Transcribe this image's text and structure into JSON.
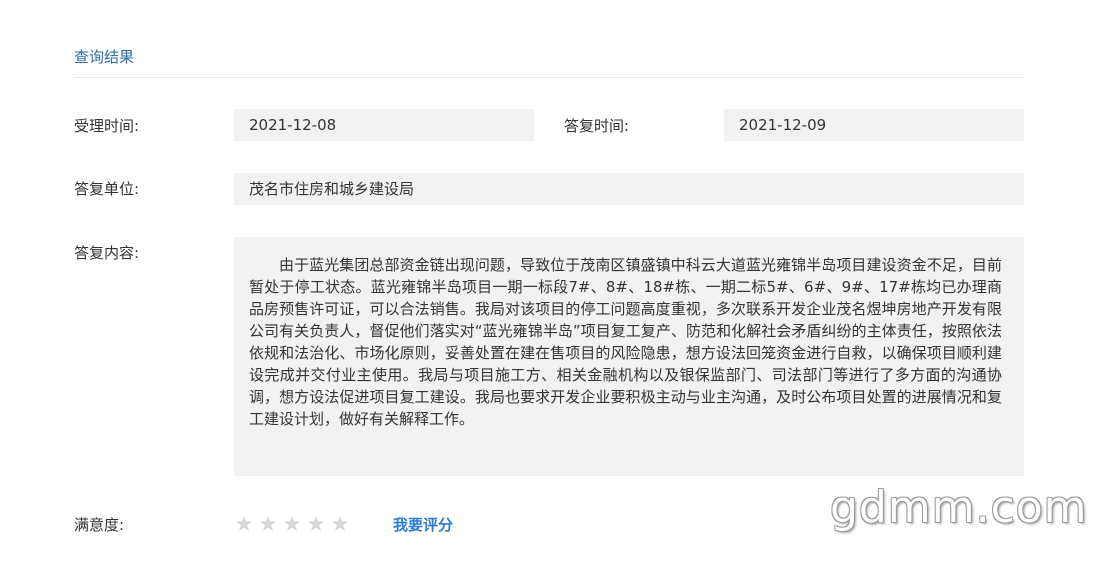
{
  "section_title": "查询结果",
  "accept_time": {
    "label": "受理时间:",
    "value": "2021-12-08"
  },
  "reply_time": {
    "label": "答复时间:",
    "value": "2021-12-09"
  },
  "reply_unit": {
    "label": "答复单位:",
    "value": "茂名市住房和城乡建设局"
  },
  "reply_content": {
    "label": "答复内容:",
    "text": "由于蓝光集团总部资金链出现问题，导致位于茂南区镇盛镇中科云大道蓝光雍锦半岛项目建设资金不足，目前暂处于停工状态。蓝光雍锦半岛项目一期一标段7#、8#、18#栋、一期二标5#、6#、9#、17#栋均已办理商品房预售许可证，可以合法销售。我局对该项目的停工问题高度重视，多次联系开发企业茂名煜坤房地产开发有限公司有关负责人，督促他们落实对“蓝光雍锦半岛”项目复工复产、防范和化解社会矛盾纠纷的主体责任，按照依法依规和法治化、市场化原则，妥善处置在建在售项目的风险隐患，想方设法回笼资金进行自救，以确保项目顺利建设完成并交付业主使用。我局与项目施工方、相关金融机构以及银保监部门、司法部门等进行了多方面的沟通协调，想方设法促进项目复工建设。我局也要求开发企业要积极主动与业主沟通，及时公布项目处置的进展情况和复工建设计划，做好有关解释工作。"
  },
  "satisfaction": {
    "label": "满意度:",
    "stars_total": 5,
    "stars_filled": 0,
    "star_glyph": "★",
    "star_color": "#d6d6d6",
    "rate_link": "我要评分"
  },
  "watermark": "gdmm.com",
  "colors": {
    "title": "#2e6da4",
    "link": "#2b7bd3",
    "field_bg": "#f2f2f2"
  }
}
